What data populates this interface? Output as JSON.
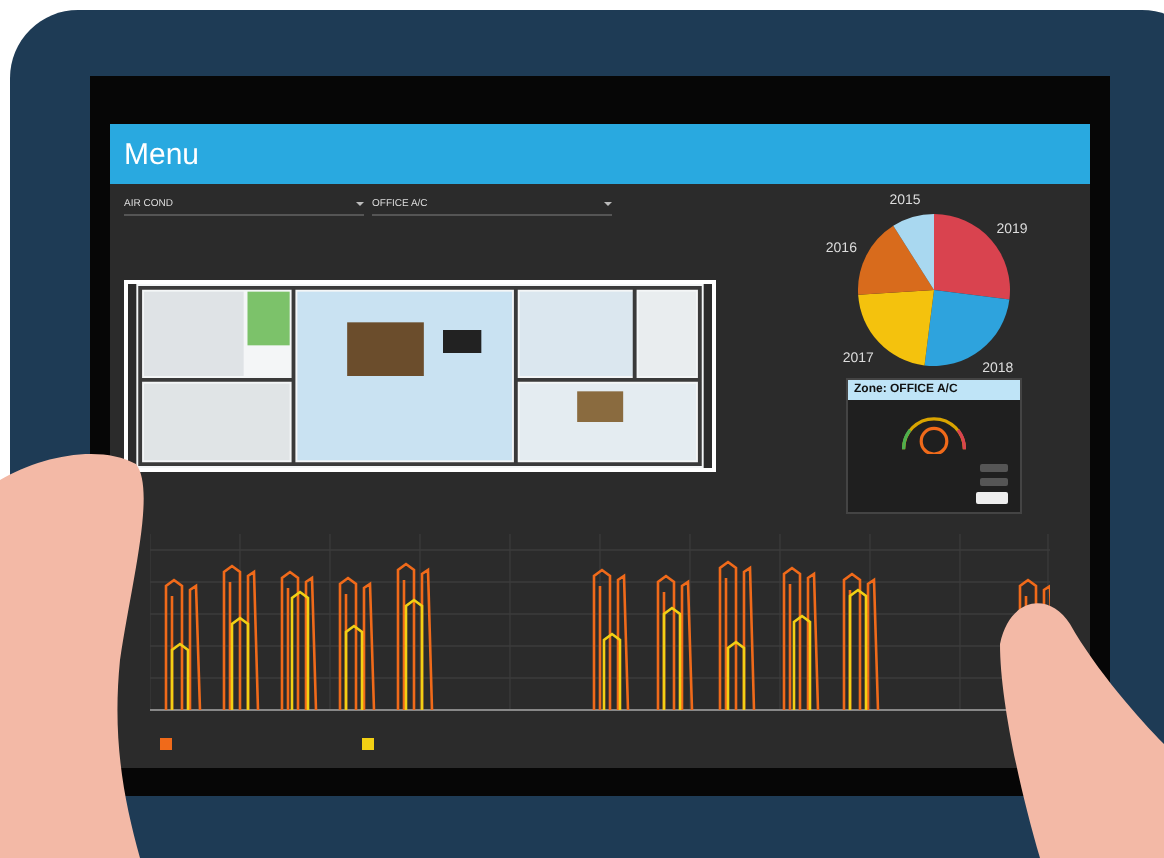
{
  "header": {
    "title": "Menu"
  },
  "selectors": [
    {
      "value": "AIR COND"
    },
    {
      "value": "OFFICE A/C"
    }
  ],
  "pie": {
    "slices": [
      {
        "label": "2019",
        "color": "#d9434f"
      },
      {
        "label": "2018",
        "color": "#2ea3dd"
      },
      {
        "label": "2017",
        "color": "#f4c20d"
      },
      {
        "label": "2016",
        "color": "#d86b1c"
      },
      {
        "label": "2015",
        "color": "#a9d8f0"
      }
    ]
  },
  "zone_card": {
    "title": "Zone: OFFICE A/C"
  },
  "usage_chart": {
    "series": [
      {
        "color": "#f06a1a"
      },
      {
        "color": "#f2d014"
      }
    ]
  }
}
